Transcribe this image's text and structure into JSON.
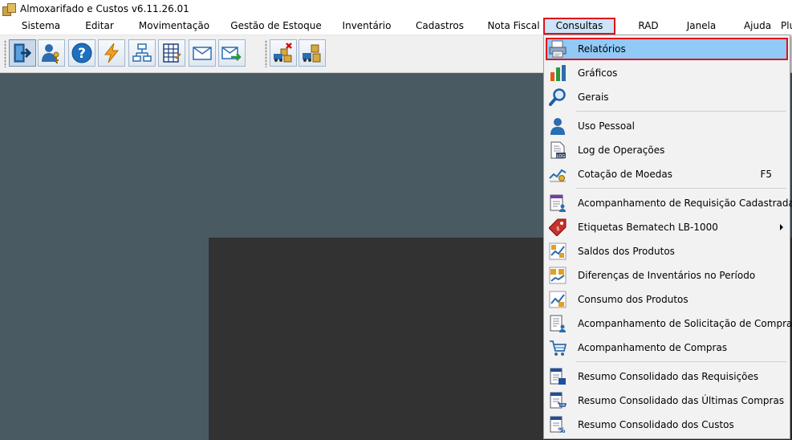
{
  "window": {
    "title": "Almoxarifado e Custos v6.11.26.01"
  },
  "menubar": {
    "items": [
      {
        "label": "Sistema"
      },
      {
        "label": "Editar"
      },
      {
        "label": "Movimentação"
      },
      {
        "label": "Gestão de Estoque"
      },
      {
        "label": "Inventário"
      },
      {
        "label": "Cadastros"
      },
      {
        "label": "Nota Fiscal"
      },
      {
        "label": "Consultas"
      },
      {
        "label": "RAD"
      },
      {
        "label": "Janela"
      },
      {
        "label": "Ajuda"
      },
      {
        "label": "Plu"
      }
    ]
  },
  "toolbar": {
    "buttons": [
      {
        "icon": "exit-door-icon"
      },
      {
        "icon": "user-key-icon"
      },
      {
        "icon": "help-question-icon"
      },
      {
        "icon": "lightning-icon"
      },
      {
        "icon": "org-chart-icon"
      },
      {
        "icon": "calculator-grid-icon"
      },
      {
        "icon": "envelope-icon"
      },
      {
        "icon": "envelope-arrow-icon"
      },
      {
        "icon": "truck-boxes-remove-icon"
      },
      {
        "icon": "truck-boxes-icon"
      }
    ]
  },
  "consultas_menu": {
    "items": [
      {
        "label": "Relatórios",
        "icon": "report-printer-icon",
        "shortcut": "",
        "submenu": false
      },
      {
        "label": "Gráficos",
        "icon": "bar-chart-icon",
        "shortcut": "",
        "submenu": false
      },
      {
        "label": "Gerais",
        "icon": "magnifier-icon",
        "shortcut": "",
        "submenu": false
      },
      {
        "label": "Uso Pessoal",
        "icon": "person-icon",
        "shortcut": "",
        "submenu": false
      },
      {
        "label": "Log de Operações",
        "icon": "log-file-icon",
        "shortcut": "",
        "submenu": false
      },
      {
        "label": "Cotação de Moedas",
        "icon": "currency-chart-icon",
        "shortcut": "F5",
        "submenu": false
      },
      {
        "label": "Acompanhamento de Requisição Cadastrada",
        "icon": "requisition-form-icon",
        "shortcut": "",
        "submenu": false
      },
      {
        "label": "Etiquetas Bematech LB-1000",
        "icon": "price-tag-icon",
        "shortcut": "",
        "submenu": true
      },
      {
        "label": "Saldos dos Produtos",
        "icon": "product-balance-icon",
        "shortcut": "",
        "submenu": false
      },
      {
        "label": "Diferenças de Inventários no Período",
        "icon": "inventory-difference-icon",
        "shortcut": "",
        "submenu": false
      },
      {
        "label": "Consumo dos Produtos",
        "icon": "consumption-chart-icon",
        "shortcut": "",
        "submenu": false
      },
      {
        "label": "Acompanhamento de Solicitação de Compra",
        "icon": "purchase-request-icon",
        "shortcut": "",
        "submenu": false
      },
      {
        "label": "Acompanhamento de Compras",
        "icon": "shopping-cart-icon",
        "shortcut": "",
        "submenu": false
      },
      {
        "label": "Resumo Consolidado das Requisições",
        "icon": "summary-requisitions-icon",
        "shortcut": "",
        "submenu": false
      },
      {
        "label": "Resumo Consolidado das Últimas Compras",
        "icon": "summary-purchases-icon",
        "shortcut": "",
        "submenu": false
      },
      {
        "label": "Resumo Consolidado dos Custos",
        "icon": "summary-costs-icon",
        "shortcut": "",
        "submenu": false
      }
    ]
  },
  "colors": {
    "highlight": "#91c9f7",
    "menu_active": "#cce4f7",
    "annotation_red": "#e0121b",
    "workspace": "#4a5a63",
    "dark_panel": "#323232"
  }
}
